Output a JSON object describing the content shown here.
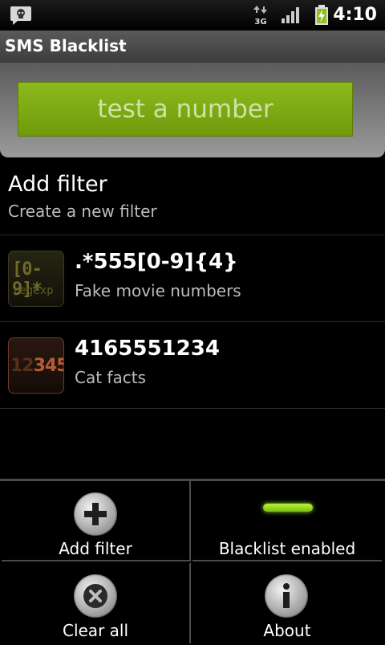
{
  "status_bar": {
    "network": "3G",
    "time": "4:10",
    "icons": [
      "sms-notification-icon",
      "3g-data-icon",
      "signal-strength-icon",
      "battery-charging-icon"
    ]
  },
  "app": {
    "title": "SMS Blacklist"
  },
  "header": {
    "test_button_label": "test a number"
  },
  "list": {
    "add_filter": {
      "title": "Add filter",
      "subtitle": "Create a new filter"
    },
    "filters": [
      {
        "pattern": ".*555[0-9]{4}",
        "description": "Fake movie numbers",
        "icon": "regexp-icon",
        "icon_text_main": "[0-9]*",
        "icon_text_sub": "regexp"
      },
      {
        "pattern": "4165551234",
        "description": "Cat facts",
        "icon": "number-icon",
        "icon_text_dim": "12",
        "icon_text_bright": "345"
      }
    ]
  },
  "menu": {
    "add_filter": "Add filter",
    "blacklist_enabled": "Blacklist enabled",
    "clear_all": "Clear all",
    "about": "About"
  },
  "colors": {
    "accent_green": "#7aa814",
    "enabled_indicator": "#9be022"
  }
}
